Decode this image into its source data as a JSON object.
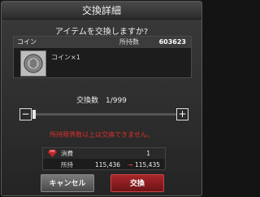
{
  "dialog": {
    "title": "交換詳細",
    "question": "アイテムを交換しますか?"
  },
  "item": {
    "name": "コイン",
    "owned_label": "所持数",
    "owned_value": "603623",
    "description": "コイン×1",
    "icon": "coin-icon"
  },
  "quantity": {
    "label": "交換数",
    "value": "1/999",
    "minus_label": "−",
    "plus_label": "+",
    "slider_fraction": 0.0
  },
  "warning": "所持限界数以上は交換できません。",
  "cost": {
    "consume_label": "消費",
    "consume_value": "1",
    "owned_label": "所持",
    "owned_before": "115,436",
    "arrow": "→",
    "owned_after": "115,435",
    "icon": "gem-icon"
  },
  "buttons": {
    "cancel": "キャンセル",
    "exchange": "交換"
  },
  "colors": {
    "warning": "#e0302a",
    "exchange_button": "#a8262a"
  }
}
